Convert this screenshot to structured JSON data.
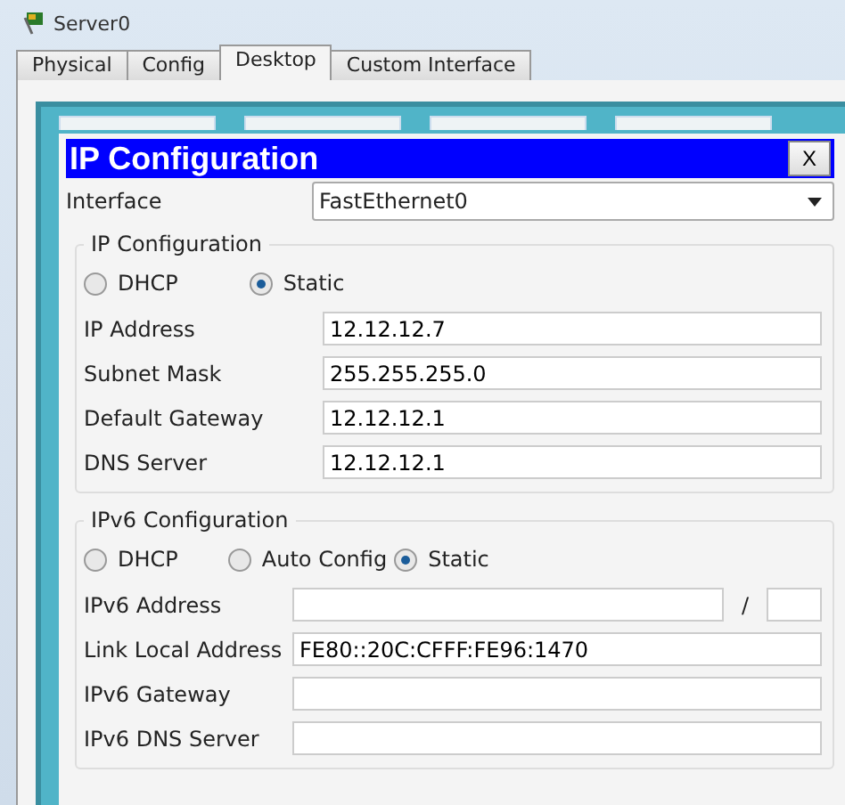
{
  "window": {
    "title": "Server0"
  },
  "tabs": [
    {
      "label": "Physical",
      "selected": false
    },
    {
      "label": "Config",
      "selected": false
    },
    {
      "label": "Desktop",
      "selected": true
    },
    {
      "label": "Custom Interface",
      "selected": false
    }
  ],
  "dialog": {
    "title": "IP Configuration",
    "close": "X",
    "interface": {
      "label": "Interface",
      "value": "FastEthernet0"
    },
    "ipv4": {
      "legend": "IP Configuration",
      "modes": [
        {
          "label": "DHCP",
          "selected": false
        },
        {
          "label": "Static",
          "selected": true
        }
      ],
      "fields": [
        {
          "label": "IP Address",
          "value": "12.12.12.7"
        },
        {
          "label": "Subnet Mask",
          "value": "255.255.255.0"
        },
        {
          "label": "Default Gateway",
          "value": "12.12.12.1"
        },
        {
          "label": "DNS Server",
          "value": "12.12.12.1"
        }
      ]
    },
    "ipv6": {
      "legend": "IPv6 Configuration",
      "modes": [
        {
          "label": "DHCP",
          "selected": false
        },
        {
          "label": "Auto Config",
          "selected": false
        },
        {
          "label": "Static",
          "selected": true
        }
      ],
      "address": {
        "label": "IPv6 Address",
        "separator": "/"
      },
      "fields": [
        {
          "label": "Link Local Address",
          "value": "FE80::20C:CFFF:FE96:1470"
        },
        {
          "label": "IPv6 Gateway"
        },
        {
          "label": "IPv6 DNS Server"
        }
      ]
    }
  }
}
